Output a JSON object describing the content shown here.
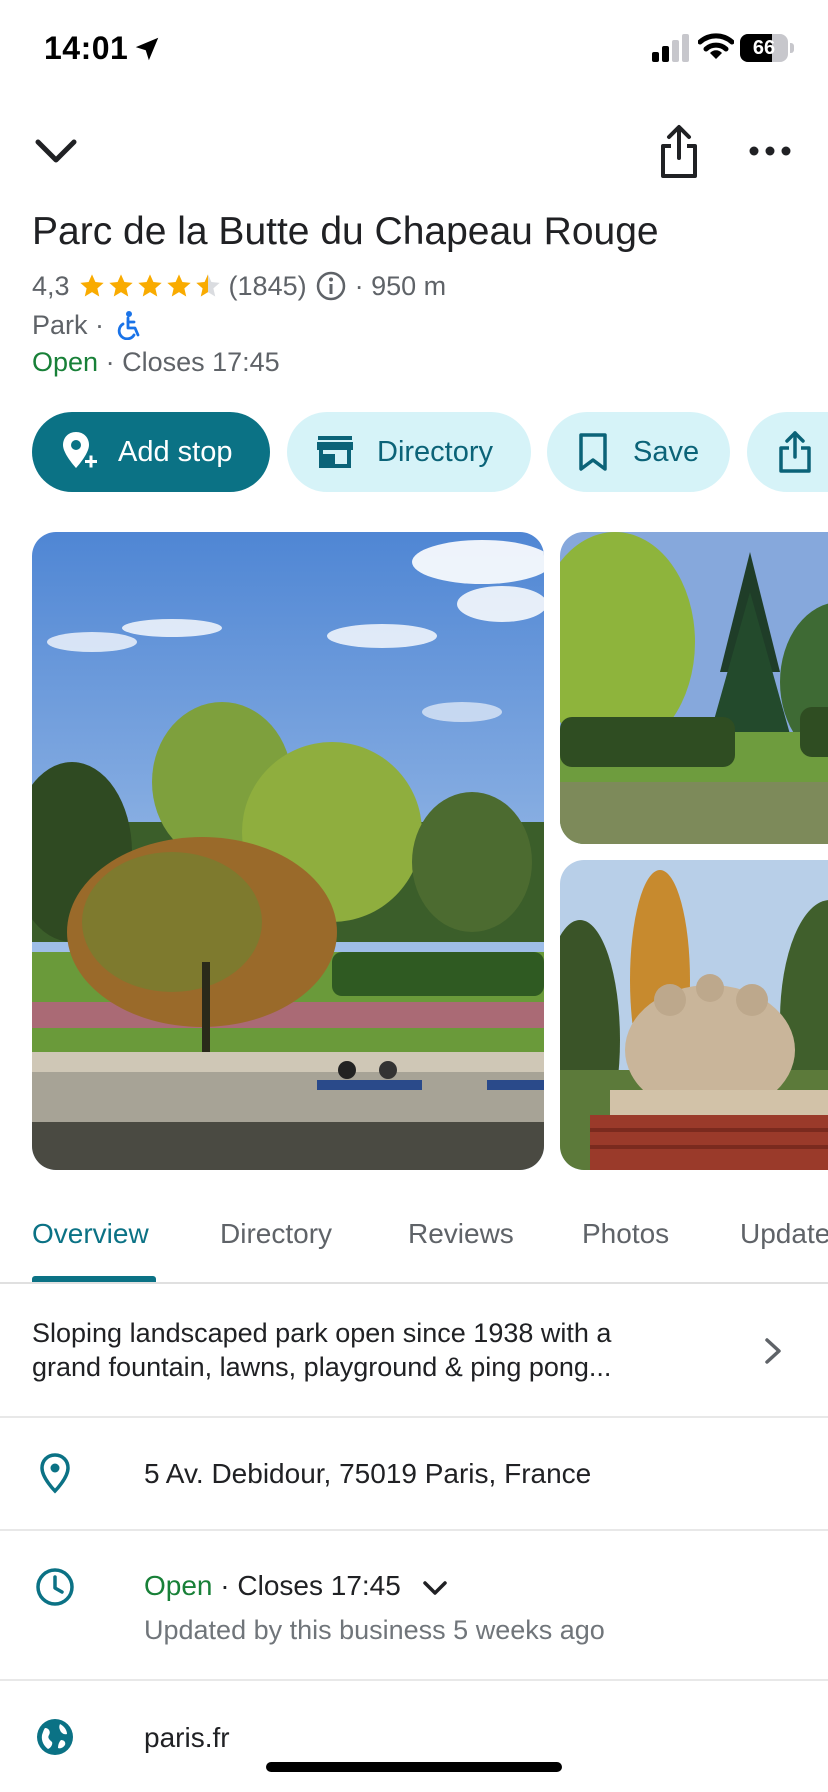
{
  "status_bar": {
    "time": "14:01",
    "battery": "66",
    "battery_level": 0.66
  },
  "place": {
    "title": "Parc de la Butte du Chapeau Rouge",
    "rating": "4,3",
    "stars": 4.3,
    "review_count": "(1845)",
    "distance": "· 950 m",
    "category": "Park ·",
    "open_status": "Open",
    "closes": "· Closes 17:45"
  },
  "actions": {
    "add_stop": "Add stop",
    "directory": "Directory",
    "save": "Save"
  },
  "tabs": [
    "Overview",
    "Directory",
    "Reviews",
    "Photos",
    "Updates"
  ],
  "overview": {
    "description_line1": "Sloping landscaped park open since 1938 with a",
    "description_line2": "grand fountain, lawns, playground & ping pong...",
    "address": "5 Av. Debidour, 75019 Paris, France",
    "hours_open": "Open",
    "hours_closes": "· Closes 17:45",
    "hours_updated": "Updated by this business 5 weeks ago",
    "website": "paris.fr"
  },
  "colors": {
    "accent": "#0b7285",
    "chip_bg": "#d6f3f8",
    "open_green": "#188038",
    "star": "#f9ab00"
  },
  "icons": [
    "location-arrow-icon",
    "signal-icon",
    "wifi-icon",
    "battery-icon",
    "chevron-down-icon",
    "share-icon",
    "more-icon",
    "star-icon",
    "info-icon",
    "wheelchair-icon",
    "add-location-icon",
    "store-icon",
    "bookmark-icon",
    "place-pin-icon",
    "clock-icon",
    "globe-icon",
    "chevron-right-icon"
  ]
}
